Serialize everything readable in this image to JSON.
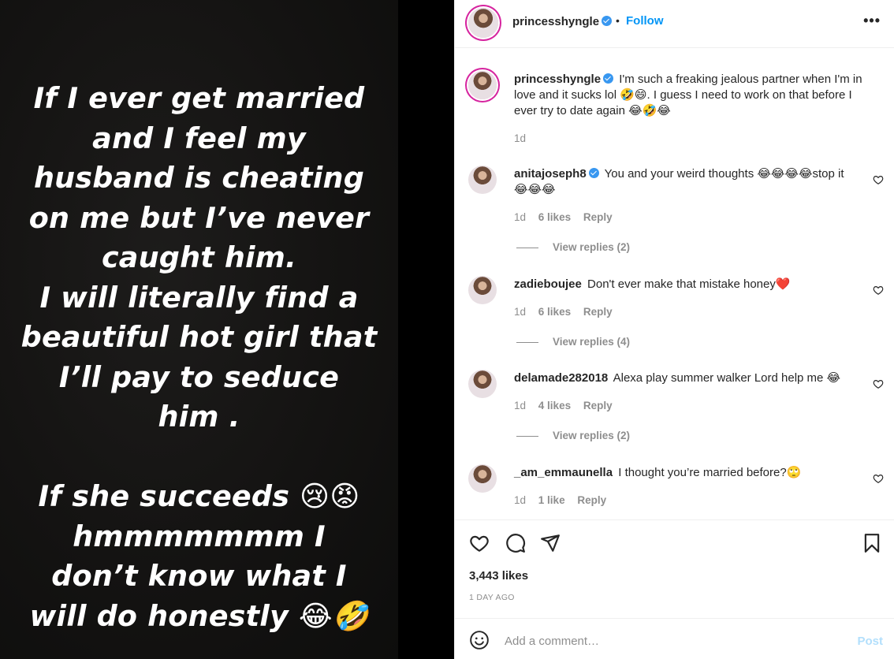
{
  "media": {
    "story_lines": [
      "If I ever get married",
      "and I feel my",
      "husband is cheating",
      "on me but I’ve never",
      "caught him.",
      "I will literally find a",
      "beautiful hot girl that",
      "I’ll pay to seduce",
      "him .",
      "",
      "If she succeeds 😢😡",
      "hmmmmmmm I",
      "don’t know what I",
      "will do honestly 😂🤣"
    ]
  },
  "header": {
    "username": "princesshyngle",
    "separator": "•",
    "follow_label": "Follow",
    "more_label": "•••"
  },
  "caption": {
    "username": "princesshyngle",
    "text": "I'm such a freaking jealous partner when I'm in love and it sucks lol 🤣😄. I guess I need to work on that before I ever try to date again 😂🤣😂",
    "time": "1d"
  },
  "comments": [
    {
      "username": "anitajoseph8",
      "text": "You and your weird thoughts 😂😂😂😂stop it😂😂😂",
      "time": "1d",
      "likes": "6 likes",
      "reply": "Reply",
      "view_replies": "View replies (2)"
    },
    {
      "username": "zadieboujee",
      "text": "Don't ever make that mistake honey❤️",
      "time": "1d",
      "likes": "6 likes",
      "reply": "Reply",
      "view_replies": "View replies (4)"
    },
    {
      "username": "delamade282018",
      "text": "Alexa play summer walker Lord help me 😂",
      "time": "1d",
      "likes": "4 likes",
      "reply": "Reply",
      "view_replies": "View replies (2)"
    },
    {
      "username": "_am_emmaunella",
      "text": "I thought you’re married before?🙄",
      "time": "1d",
      "likes": "1 like",
      "reply": "Reply"
    }
  ],
  "actions": {
    "icons": [
      "heart-icon",
      "comment-icon",
      "share-icon",
      "bookmark-icon"
    ],
    "likes": "3,443 likes",
    "time_ago": "1 DAY AGO"
  },
  "add_comment": {
    "placeholder": "Add a comment…",
    "post_label": "Post",
    "post_color": "#b2dffc"
  },
  "colors": {
    "accent": "#0095f6",
    "verified": "#3897f0",
    "muted": "#8e8e8e"
  }
}
